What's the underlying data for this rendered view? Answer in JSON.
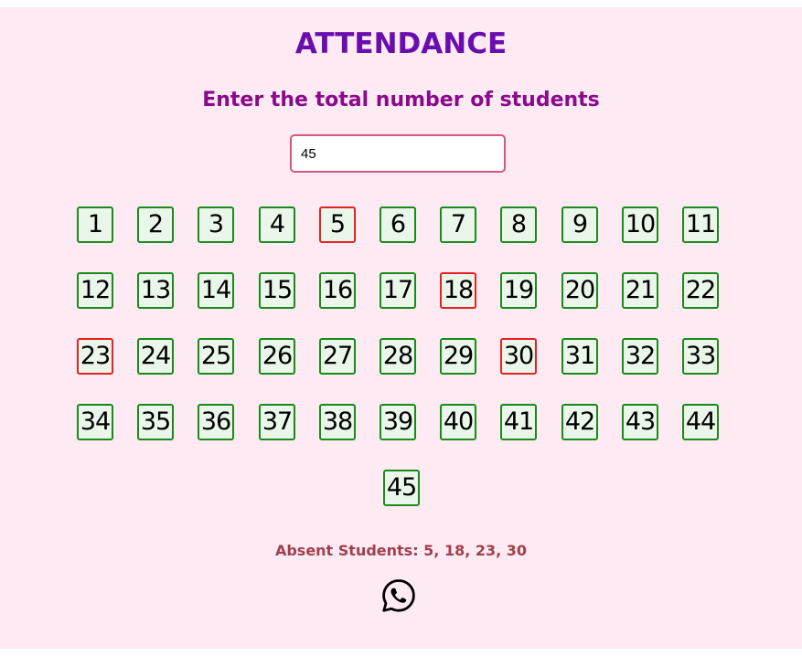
{
  "header": {
    "title": "ATTENDANCE",
    "subtitle": "Enter the total number of students"
  },
  "input": {
    "value": "45"
  },
  "students": {
    "total": 45,
    "absent": [
      5,
      18,
      23,
      30
    ]
  },
  "summary": {
    "absent_text": "Absent Students: 5, 18, 23, 30"
  },
  "share": {
    "icon": "whatsapp-icon"
  },
  "colors": {
    "title": "#6a0dad",
    "subtitle": "#8b0a8b",
    "present_border": "#1a8a1a",
    "absent_border": "#e62121",
    "background": "#fdeaf3"
  }
}
